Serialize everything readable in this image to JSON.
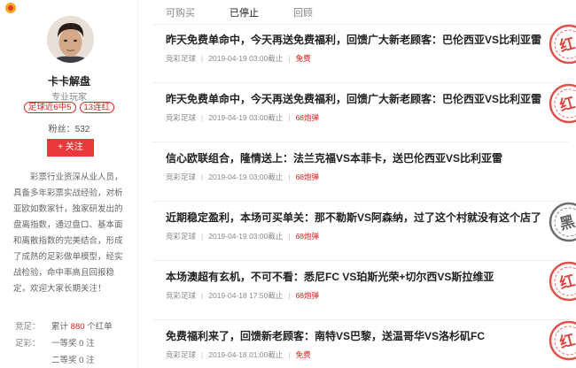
{
  "sidebar": {
    "name": "卡卡解盘",
    "title": "专业玩家",
    "badges": [
      "足球近6中5",
      "13连红"
    ],
    "fans_label": "粉丝：",
    "fans_count": "532",
    "follow_label": "+ 关注",
    "intro": "彩票行业资深从业人员，具备多年彩票实战经验，对析亚欧如数家针，独家研发出的盘离指数，通过盘口、基本面和离散指数的完美结合，形成了成熟的足彩做单模型，经实战检验，命中率高且回报稳定，欢迎大家长期关注！",
    "stats": [
      {
        "label": "竞足：",
        "prefix": "累计",
        "num": "880",
        "suffix": "个红单"
      },
      {
        "label": "足彩：",
        "prefix": "一等奖",
        "num": "0",
        "suffix": "注"
      },
      {
        "label": "",
        "prefix": "二等奖",
        "num": "0",
        "suffix": "注"
      }
    ]
  },
  "tabs": [
    "可购买",
    "已停止",
    "回顾"
  ],
  "active_tab": "已停止",
  "articles": [
    {
      "title": "昨天免费单命中，今天再送免费福利，回馈广大新老顾客：巴伦西亚VS比利亚雷",
      "category": "竞彩足球",
      "time": "2019-04-19 03:00截止",
      "price": "免费",
      "stamp": "红"
    },
    {
      "title": "昨天免费单命中，今天再送免费福利，回馈广大新老顾客：巴伦西亚VS比利亚雷",
      "category": "竞彩足球",
      "time": "2019-04-19 03:00截止",
      "price": "68炮弹",
      "stamp": "红"
    },
    {
      "title": "信心欧联组合，隆情送上：法兰克福VS本菲卡，送巴伦西亚VS比利亚雷",
      "category": "竞彩足球",
      "time": "2019-04-19 03:00截止",
      "price": "68炮弹",
      "stamp": ""
    },
    {
      "title": "近期稳定盈利，本场可买单关：那不勒斯VS阿森纳，过了这个村就没有这个店了",
      "category": "竞彩足球",
      "time": "2019-04-19 03:00截止",
      "price": "68炮弹",
      "stamp": "黑"
    },
    {
      "title": "本场澳超有玄机，不可不看：悉尼FC VS珀斯光荣+切尔西VS斯拉维亚",
      "category": "竞彩足球",
      "time": "2019-04-18 17:50截止",
      "price": "68炮弹",
      "stamp": "红"
    },
    {
      "title": "免费福利来了，回馈新老顾客：南特VS巴黎，送温哥华VS洛杉矶FC",
      "category": "竞彩足球",
      "time": "2019-04-18 01:00截止",
      "price": "免费",
      "stamp": "红"
    }
  ],
  "colors": {
    "accent": "#e02020",
    "stamp_red": "#d9322b",
    "stamp_black": "#555555"
  },
  "icons": {
    "logo": "brand-logo-icon",
    "avatar": "user-avatar"
  }
}
